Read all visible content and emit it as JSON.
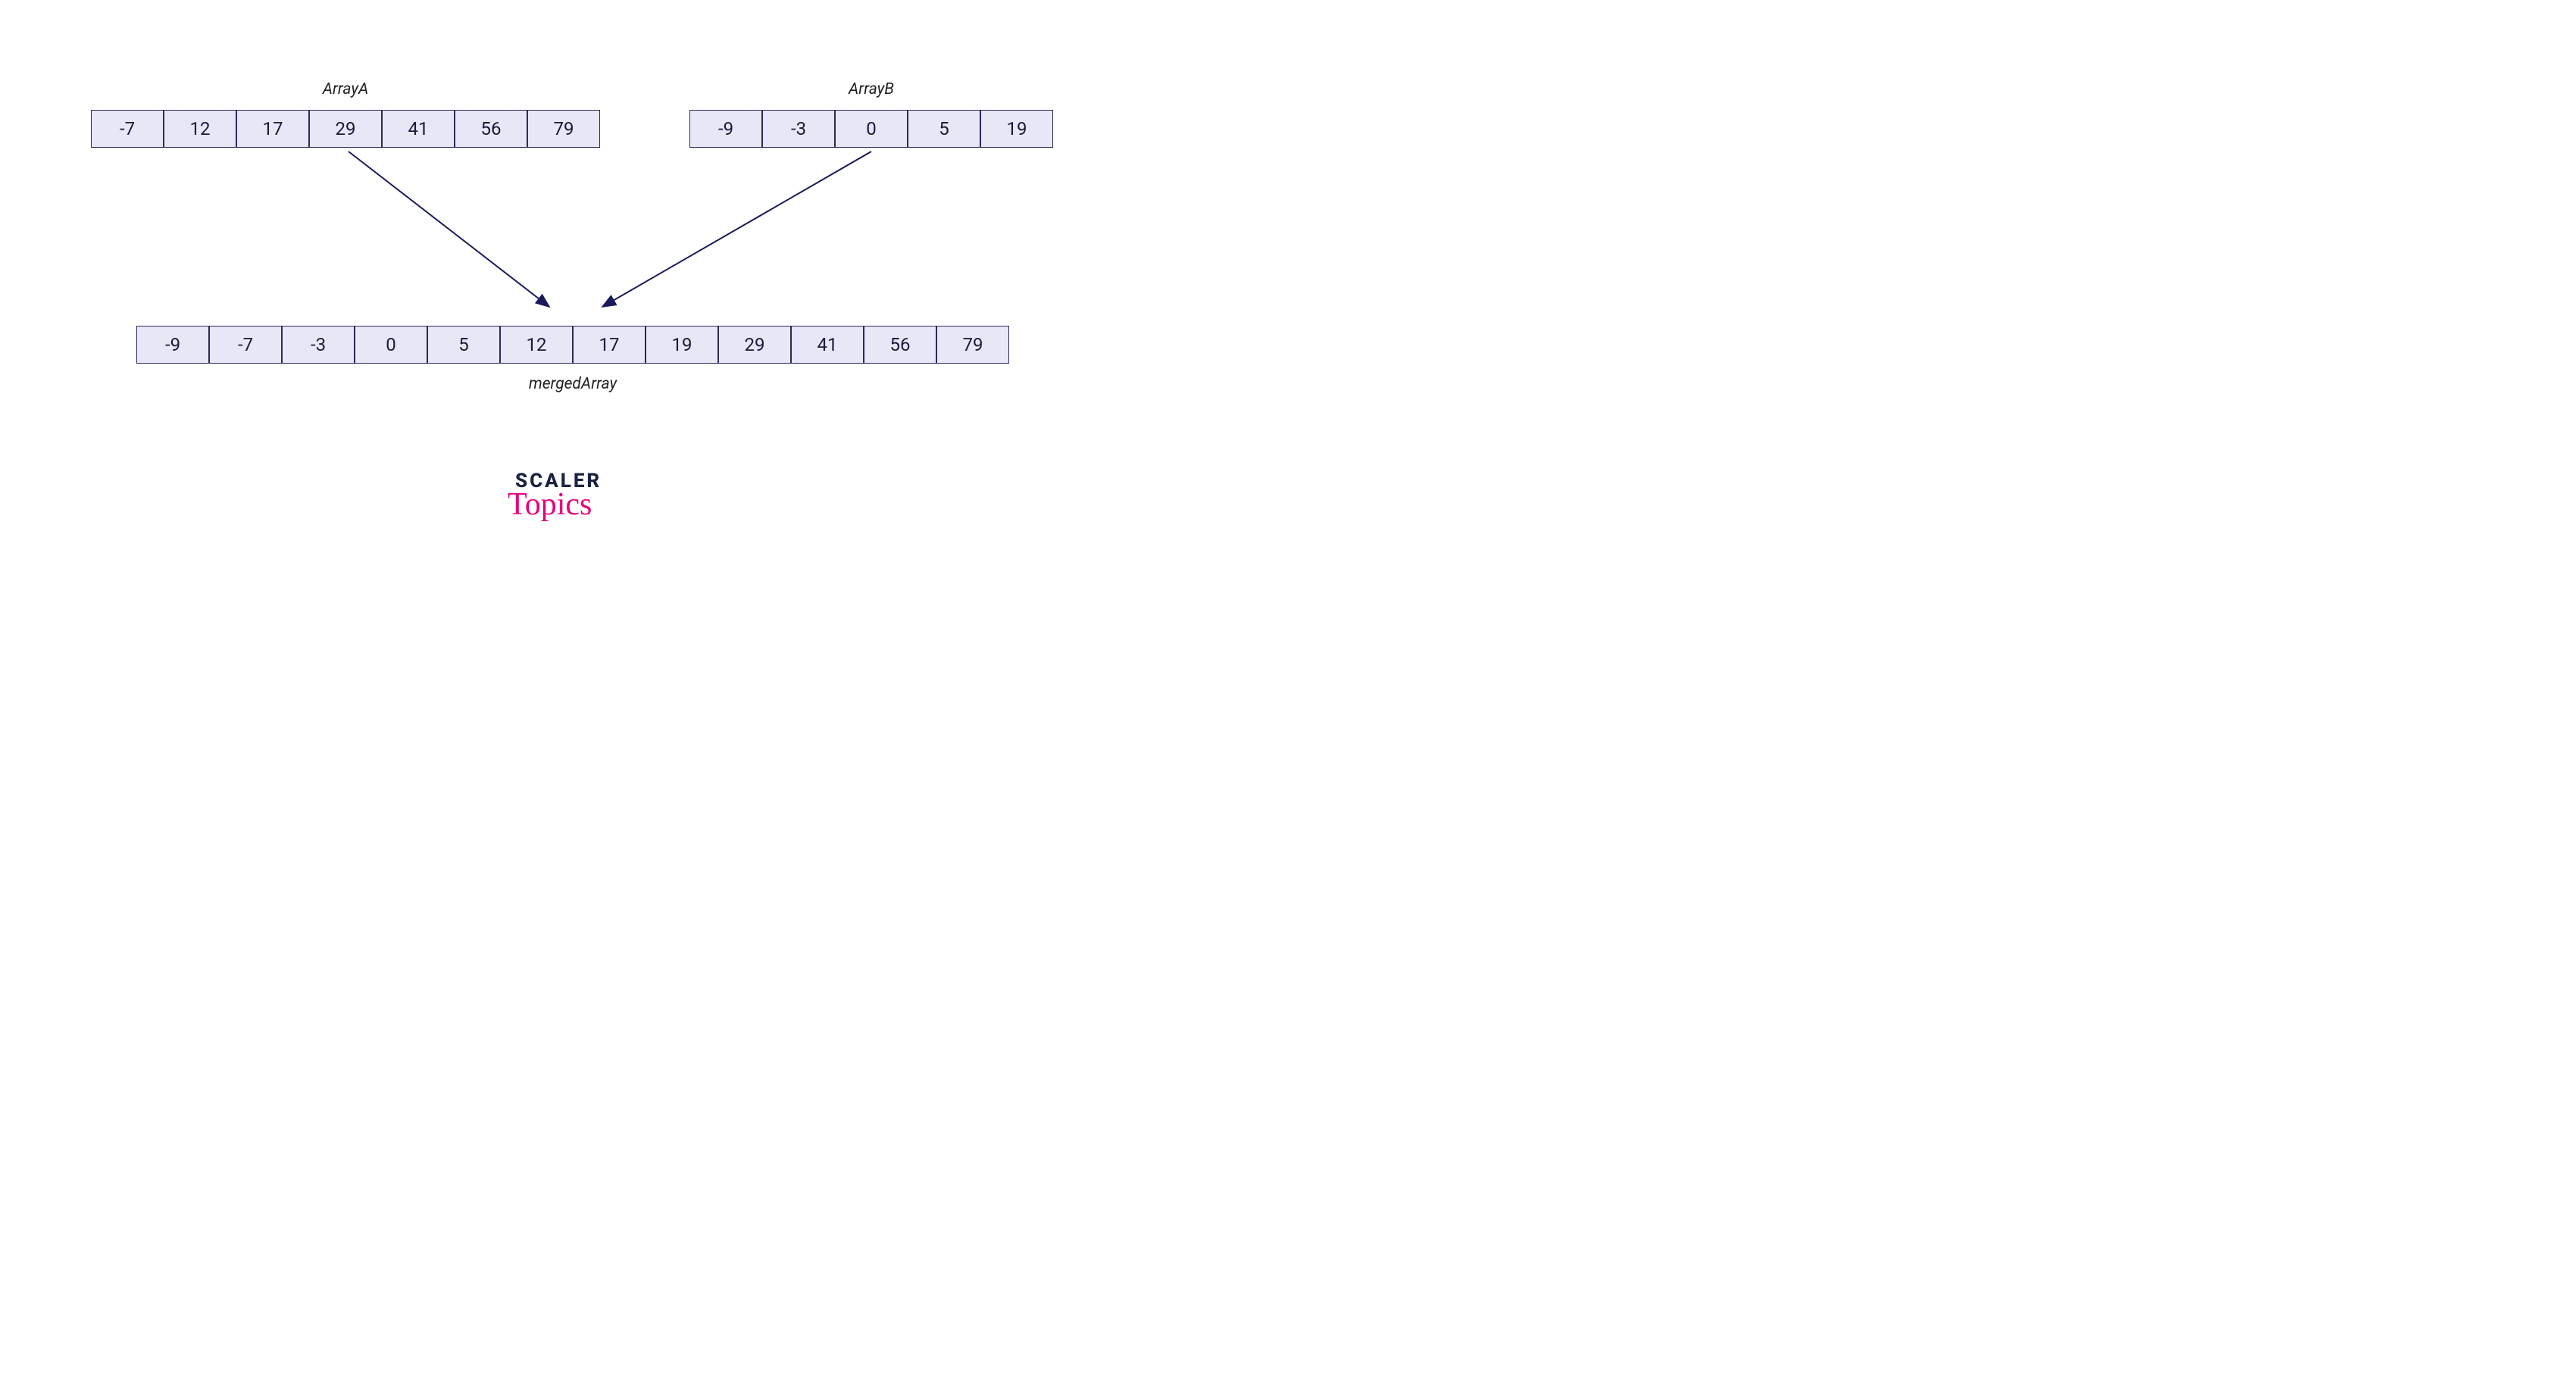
{
  "labels": {
    "arrayA": "ArrayA",
    "arrayB": "ArrayB",
    "merged": "mergedArray"
  },
  "arrayA": [
    "-7",
    "12",
    "17",
    "29",
    "41",
    "56",
    "79"
  ],
  "arrayB": [
    "-9",
    "-3",
    "0",
    "5",
    "19"
  ],
  "mergedArray": [
    "-9",
    "-7",
    "-3",
    "0",
    "5",
    "12",
    "17",
    "19",
    "29",
    "41",
    "56",
    "79"
  ],
  "branding": {
    "line1": "SCALER",
    "line2": "Topics"
  }
}
